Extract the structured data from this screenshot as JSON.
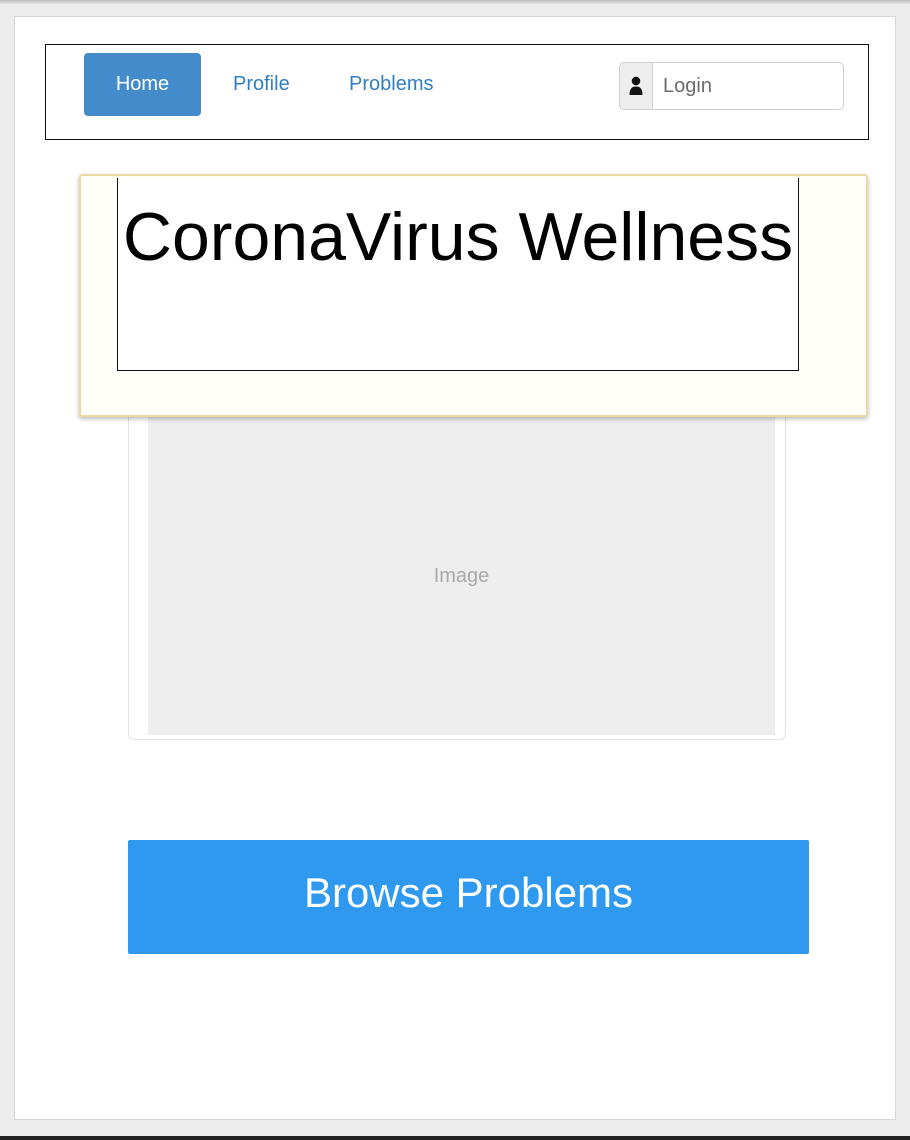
{
  "nav": {
    "items": [
      {
        "label": "Home",
        "active": true
      },
      {
        "label": "Profile",
        "active": false
      },
      {
        "label": "Problems",
        "active": false
      }
    ],
    "login": {
      "icon": "user-icon",
      "placeholder": "Login",
      "value": ""
    }
  },
  "hero": {
    "title": "CoronaVirus Wellness"
  },
  "image": {
    "label": "Image"
  },
  "browse_button": {
    "label": "Browse Problems"
  },
  "colors": {
    "nav_active": "#438bca",
    "nav_link": "#2f7fc1",
    "primary_button": "#2e99ee",
    "highlight_border": "#ead9a2",
    "image_placeholder": "#eeeeee"
  }
}
